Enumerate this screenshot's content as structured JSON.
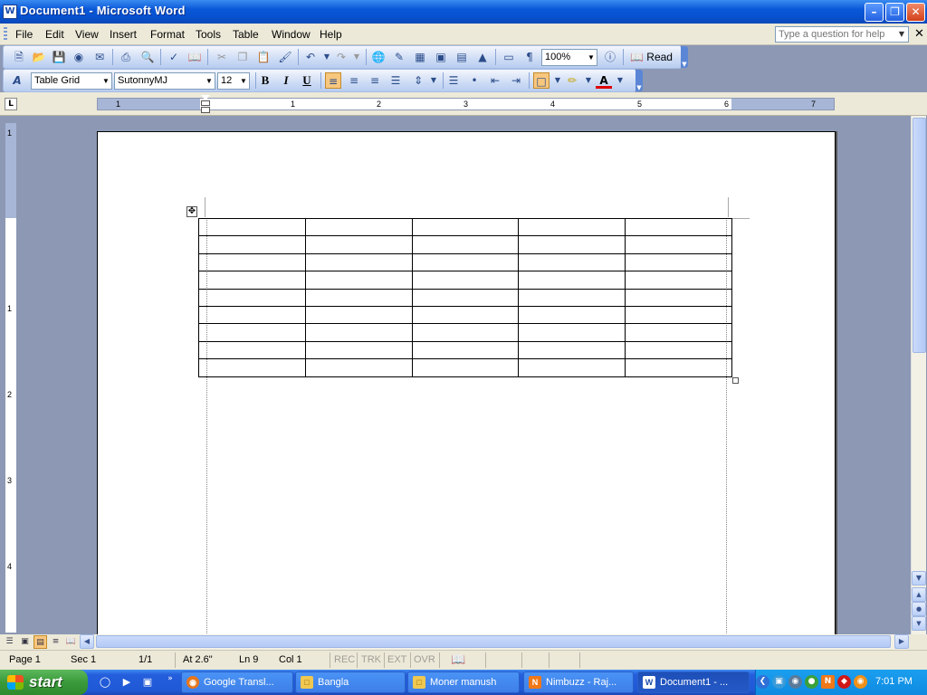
{
  "window": {
    "title": "Document1 - Microsoft Word",
    "app_icon": "W"
  },
  "menu": {
    "items": [
      "File",
      "Edit",
      "View",
      "Insert",
      "Format",
      "Tools",
      "Table",
      "Window",
      "Help"
    ],
    "help_placeholder": "Type a question for help"
  },
  "toolbar": {
    "zoom": "100%",
    "read_label": "Read"
  },
  "formatting": {
    "style": "Table Grid",
    "font": "SutonnyMJ",
    "size": "12",
    "bold": "B",
    "italic": "I",
    "underline": "U",
    "font_color_glyph": "A"
  },
  "ruler": {
    "h_numbers": [
      "1",
      "1",
      "2",
      "3",
      "4",
      "5",
      "6",
      "7"
    ],
    "v_numbers": [
      "1",
      "1",
      "2",
      "3",
      "4"
    ]
  },
  "table": {
    "rows": 9,
    "cols": 5
  },
  "status": {
    "page": "Page 1",
    "sec": "Sec 1",
    "pages": "1/1",
    "at": "At 2.6\"",
    "ln": "Ln 9",
    "col": "Col 1",
    "rec": "REC",
    "trk": "TRK",
    "ext": "EXT",
    "ovr": "OVR"
  },
  "taskbar": {
    "start_label": "start",
    "tasks": [
      {
        "label": "Google Transl...",
        "icon": "firefox-icon",
        "color": "#e8761a"
      },
      {
        "label": "Bangla",
        "icon": "folder-icon",
        "color": "#f0c850"
      },
      {
        "label": "Moner manush",
        "icon": "folder-icon",
        "color": "#f0c850"
      },
      {
        "label": "Nimbuzz - Raj...",
        "icon": "nimbuzz-icon",
        "color": "#f07818"
      },
      {
        "label": "Document1 - ...",
        "icon": "word-icon",
        "color": "#ffffff"
      }
    ],
    "clock": "7:01 PM"
  }
}
